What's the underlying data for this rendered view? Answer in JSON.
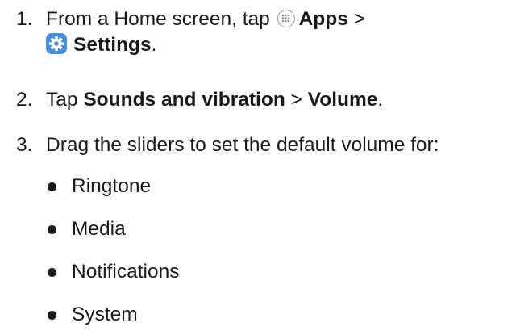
{
  "steps": [
    {
      "number": "1.",
      "prefix": "From a Home screen, tap",
      "apps_label": "Apps",
      "separator": ">",
      "settings_label": "Settings",
      "suffix": "."
    },
    {
      "number": "2.",
      "prefix": "Tap",
      "sounds_label": "Sounds and vibration",
      "separator": ">",
      "volume_label": "Volume",
      "suffix": "."
    },
    {
      "number": "3.",
      "text": "Drag the sliders to set the default volume for:"
    }
  ],
  "bullets": [
    "Ringtone",
    "Media",
    "Notifications",
    "System"
  ],
  "icons": {
    "apps": "apps-grid-icon",
    "settings": "gear-icon"
  },
  "colors": {
    "text": "#1a1a1a",
    "settings_icon_bg": "#4a90d9",
    "apps_icon_border": "#9a9a9a"
  }
}
